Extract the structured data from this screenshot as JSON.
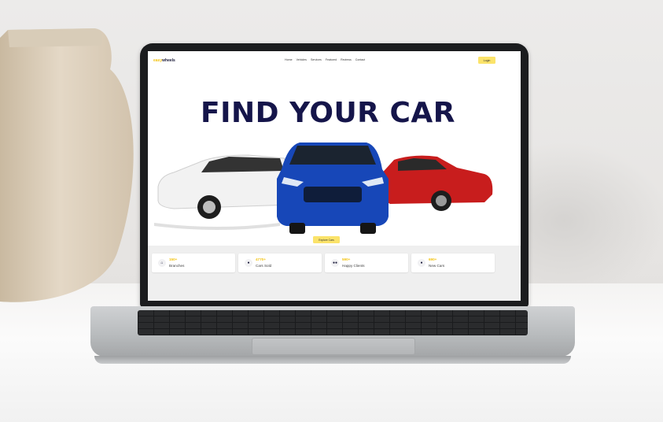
{
  "site": {
    "logo_accent": "easy",
    "logo_main": "wheels",
    "nav": [
      "Home",
      "Vehicles",
      "Services",
      "Featured",
      "Reviews",
      "Contact"
    ],
    "login_label": "Login",
    "hero_title": "FIND YOUR CAR",
    "explore_label": "Explore Cars",
    "stats": [
      {
        "value": "150+",
        "label": "Branches",
        "icon": "home-icon"
      },
      {
        "value": "4770+",
        "label": "Cars Sold",
        "icon": "car-icon"
      },
      {
        "value": "590+",
        "label": "Happy Clients",
        "icon": "users-icon"
      },
      {
        "value": "690+",
        "label": "New Cars",
        "icon": "car-icon"
      }
    ]
  },
  "colors": {
    "accent_yellow": "#f3c312",
    "button_yellow": "#fbe36a",
    "title_navy": "#15154a",
    "car_white": "#f2f2f2",
    "car_blue": "#1747b8",
    "car_red": "#c81d1d"
  }
}
